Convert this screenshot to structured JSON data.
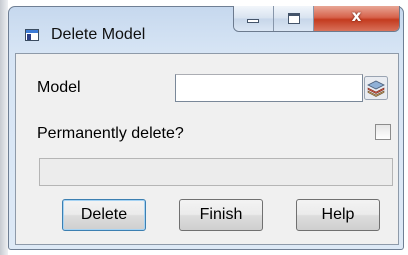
{
  "window": {
    "title": "Delete Model"
  },
  "caption_buttons": {
    "close_glyph": "x"
  },
  "form": {
    "model_label": "Model",
    "model_value": "",
    "permanently_delete_label": "Permanently delete?",
    "permanently_delete_checked": false,
    "status_text": ""
  },
  "buttons": {
    "delete_label": "Delete",
    "finish_label": "Finish",
    "help_label": "Help"
  },
  "icons": {
    "app": "window-icon",
    "model_picker": "layers-icon"
  }
}
